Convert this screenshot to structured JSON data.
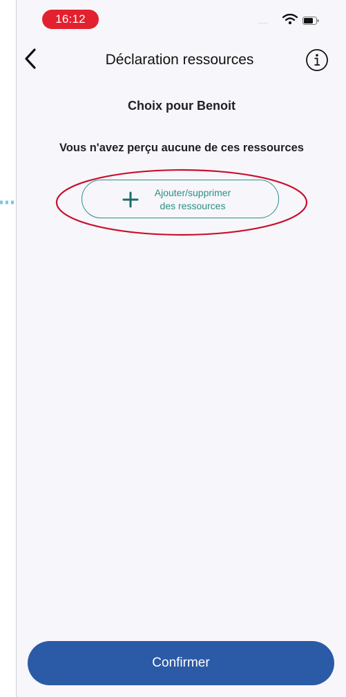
{
  "status_bar": {
    "time": "16:12",
    "signal": "...."
  },
  "nav": {
    "title": "Déclaration ressources",
    "back_icon": "chevron-left-icon",
    "info_icon": "info-circle-icon"
  },
  "content": {
    "subtitle": "Choix pour Benoit",
    "empty_message": "Vous n'avez perçu aucune de ces ressources",
    "add_button": {
      "line1": "Ajouter/supprimer",
      "line2": "des ressources",
      "icon": "plus-icon"
    }
  },
  "footer": {
    "confirm_label": "Confirmer"
  },
  "colors": {
    "time_pill": "#e3202e",
    "accent_teal": "#2a8f88",
    "primary_blue": "#2b5aa6",
    "annotation_red": "#c8102e",
    "annotation_arrow": "#7cc6e0",
    "background": "#f7f6fa"
  }
}
